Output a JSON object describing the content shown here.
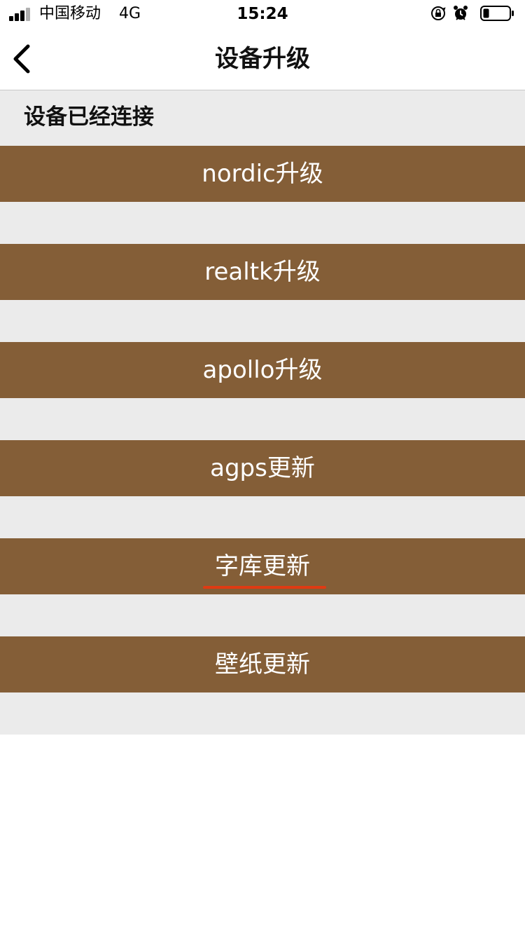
{
  "status_bar": {
    "carrier": "中国移动",
    "network": "4G",
    "time": "15:24",
    "icons": [
      "signal-icon",
      "orientation-lock-icon",
      "alarm-icon",
      "battery-icon"
    ]
  },
  "nav": {
    "title": "设备升级",
    "back_icon": "chevron-left-icon"
  },
  "connection_status": "设备已经连接",
  "buttons": [
    {
      "label": "nordic升级"
    },
    {
      "label": "realtk升级"
    },
    {
      "label": "apollo升级"
    },
    {
      "label": "agps更新"
    },
    {
      "label": "字库更新"
    },
    {
      "label": "壁纸更新"
    }
  ],
  "colors": {
    "button_bg": "#845e37",
    "content_bg": "#ebebeb",
    "annotation_underline": "#e03a12"
  }
}
